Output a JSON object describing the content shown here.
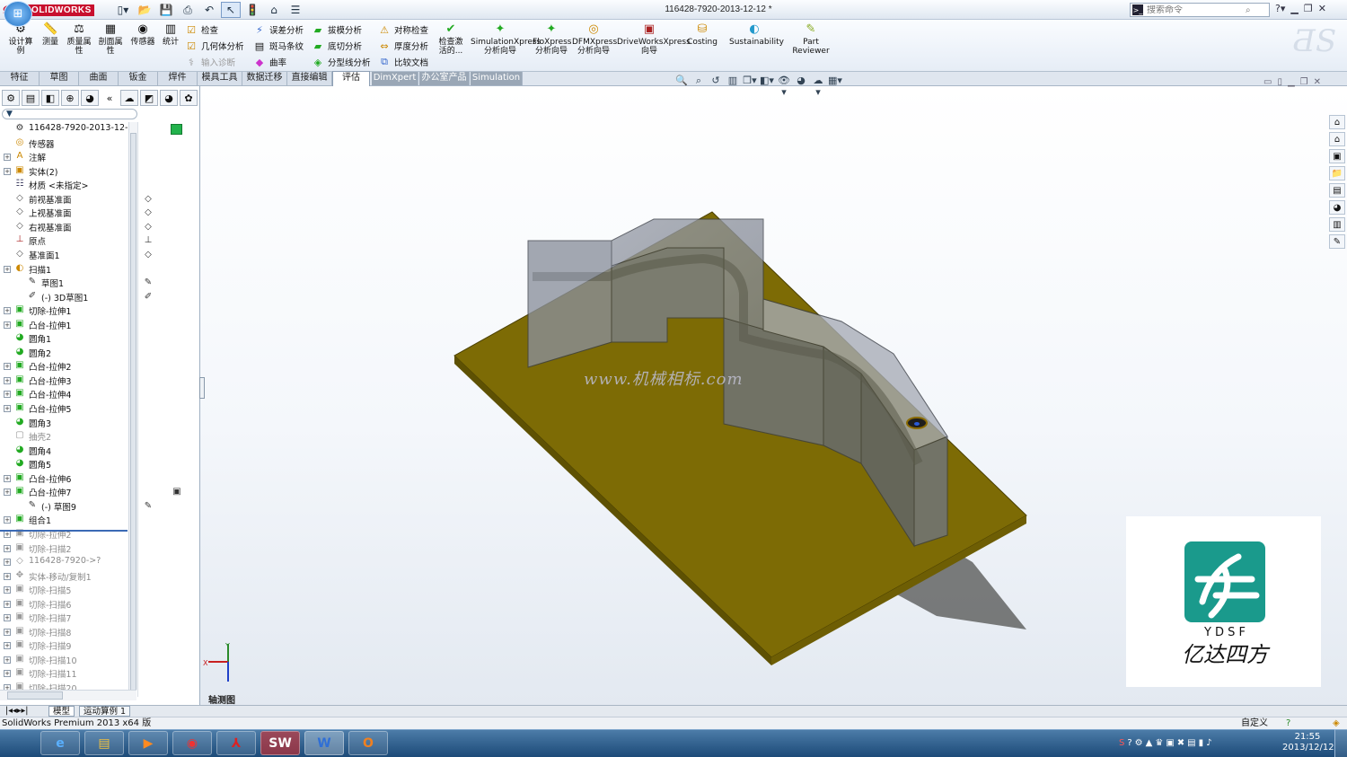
{
  "app": {
    "brand": "SOLIDWORKS",
    "doc_title": "116428-7920-2013-12-12 *",
    "search_placeholder": "搜索命令"
  },
  "colors": {
    "plate": "#7d6b05",
    "plate_top": "#a08a0a",
    "part": "#8a909c",
    "accent": "#c8102e",
    "brand_teal": "#1a9a8c"
  },
  "ribbon": {
    "big_buttons": [
      "设计算例",
      "测量",
      "质量属性",
      "剖面属性",
      "传感器",
      "统计"
    ],
    "small_col1": [
      "检查",
      "几何体分析",
      "输入诊断"
    ],
    "small_col2": [
      "误差分析",
      "斑马条纹",
      "曲率"
    ],
    "small_col3": [
      "拔模分析",
      "底切分析",
      "分型线分析"
    ],
    "small_col4": [
      "对称检查",
      "厚度分析",
      "比较文档"
    ],
    "check_active": "检查激活的...",
    "xpress": [
      "SimulationXpress分析向导",
      "FloXpress分析向导",
      "DFMXpress分析向导",
      "DriveWorksXpress向导",
      "Costing",
      "Sustainability",
      "Part Reviewer"
    ]
  },
  "command_tabs": [
    "特征",
    "草图",
    "曲面",
    "钣金",
    "焊件",
    "模具工具",
    "数据迁移",
    "直接编辑",
    "评估",
    "DimXpert",
    "办公室产品",
    "Simulation"
  ],
  "active_tab": "评估",
  "tree": {
    "root": "116428-7920-2013-12-12 (",
    "items": [
      {
        "label": "传感器",
        "icon": "sensor-icon",
        "exp": false,
        "indent": 1
      },
      {
        "label": "注解",
        "icon": "annotation-icon",
        "exp": true,
        "indent": 1
      },
      {
        "label": "实体(2)",
        "icon": "solid-bodies-icon",
        "exp": true,
        "indent": 1
      },
      {
        "label": "材质 <未指定>",
        "icon": "material-icon",
        "exp": false,
        "indent": 1
      },
      {
        "label": "前视基准面",
        "icon": "plane-icon",
        "exp": false,
        "indent": 1
      },
      {
        "label": "上视基准面",
        "icon": "plane-icon",
        "exp": false,
        "indent": 1
      },
      {
        "label": "右视基准面",
        "icon": "plane-icon",
        "exp": false,
        "indent": 1
      },
      {
        "label": "原点",
        "icon": "origin-icon",
        "exp": false,
        "indent": 1
      },
      {
        "label": "基准面1",
        "icon": "plane-icon",
        "exp": false,
        "indent": 1
      },
      {
        "label": "扫描1",
        "icon": "sweep-icon",
        "exp": true,
        "indent": 1
      },
      {
        "label": "草图1",
        "icon": "sketch-icon",
        "exp": false,
        "indent": 2
      },
      {
        "label": "(-) 3D草图1",
        "icon": "sketch3d-icon",
        "exp": false,
        "indent": 2
      },
      {
        "label": "切除-拉伸1",
        "icon": "cut-extrude-icon",
        "exp": true,
        "indent": 1
      },
      {
        "label": "凸台-拉伸1",
        "icon": "boss-extrude-icon",
        "exp": true,
        "indent": 1
      },
      {
        "label": "圆角1",
        "icon": "fillet-icon",
        "exp": false,
        "indent": 1
      },
      {
        "label": "圆角2",
        "icon": "fillet-icon",
        "exp": false,
        "indent": 1
      },
      {
        "label": "凸台-拉伸2",
        "icon": "boss-extrude-icon",
        "exp": true,
        "indent": 1
      },
      {
        "label": "凸台-拉伸3",
        "icon": "boss-extrude-icon",
        "exp": true,
        "indent": 1
      },
      {
        "label": "凸台-拉伸4",
        "icon": "boss-extrude-icon",
        "exp": true,
        "indent": 1
      },
      {
        "label": "凸台-拉伸5",
        "icon": "boss-extrude-icon",
        "exp": true,
        "indent": 1
      },
      {
        "label": "圆角3",
        "icon": "fillet-icon",
        "exp": false,
        "indent": 1
      },
      {
        "label": "抽壳2",
        "icon": "shell-icon",
        "exp": false,
        "indent": 1,
        "grey": true
      },
      {
        "label": "圆角4",
        "icon": "fillet-icon",
        "exp": false,
        "indent": 1
      },
      {
        "label": "圆角5",
        "icon": "fillet-icon",
        "exp": false,
        "indent": 1
      },
      {
        "label": "凸台-拉伸6",
        "icon": "boss-extrude-icon",
        "exp": true,
        "indent": 1
      },
      {
        "label": "凸台-拉伸7",
        "icon": "boss-extrude-icon",
        "exp": true,
        "indent": 1
      },
      {
        "label": "(-) 草图9",
        "icon": "sketch-icon",
        "exp": false,
        "indent": 2
      },
      {
        "label": "组合1",
        "icon": "combine-icon",
        "exp": true,
        "indent": 1
      },
      {
        "label": "切除-拉伸2",
        "icon": "cut-extrude-icon",
        "exp": true,
        "indent": 1,
        "grey": true
      },
      {
        "label": "切除-扫描2",
        "icon": "cut-sweep-icon",
        "exp": true,
        "indent": 1,
        "grey": true
      },
      {
        "label": "116428-7920->?",
        "icon": "part-ref-icon",
        "exp": true,
        "indent": 1,
        "grey": true
      },
      {
        "label": "实体-移动/复制1",
        "icon": "move-copy-icon",
        "exp": true,
        "indent": 1,
        "grey": true
      },
      {
        "label": "切除-扫描5",
        "icon": "cut-sweep-icon",
        "exp": true,
        "indent": 1,
        "grey": true
      },
      {
        "label": "切除-扫描6",
        "icon": "cut-sweep-icon",
        "exp": true,
        "indent": 1,
        "grey": true
      },
      {
        "label": "切除-扫描7",
        "icon": "cut-sweep-icon",
        "exp": true,
        "indent": 1,
        "grey": true
      },
      {
        "label": "切除-扫描8",
        "icon": "cut-sweep-icon",
        "exp": true,
        "indent": 1,
        "grey": true
      },
      {
        "label": "切除-扫描9",
        "icon": "cut-sweep-icon",
        "exp": true,
        "indent": 1,
        "grey": true
      },
      {
        "label": "切除-扫描10",
        "icon": "cut-sweep-icon",
        "exp": true,
        "indent": 1,
        "grey": true
      },
      {
        "label": "切除-扫描11",
        "icon": "cut-sweep-icon",
        "exp": true,
        "indent": 1,
        "grey": true
      },
      {
        "label": "切除-扫描20",
        "icon": "cut-sweep-icon",
        "exp": true,
        "indent": 1,
        "grey": true
      }
    ]
  },
  "viewport": {
    "view_label": "轴测图",
    "watermark": "www.机械相标.com",
    "triad": {
      "x": "X",
      "y": "Y"
    }
  },
  "brand_box": {
    "letters": "Y D S F",
    "name": "亿达四方"
  },
  "sheet_tabs": [
    "模型",
    "运动算例 1"
  ],
  "status": {
    "left": "SolidWorks Premium 2013 x64 版",
    "right": "自定义"
  },
  "clock": {
    "time": "21:55",
    "date": "2013/12/12"
  }
}
